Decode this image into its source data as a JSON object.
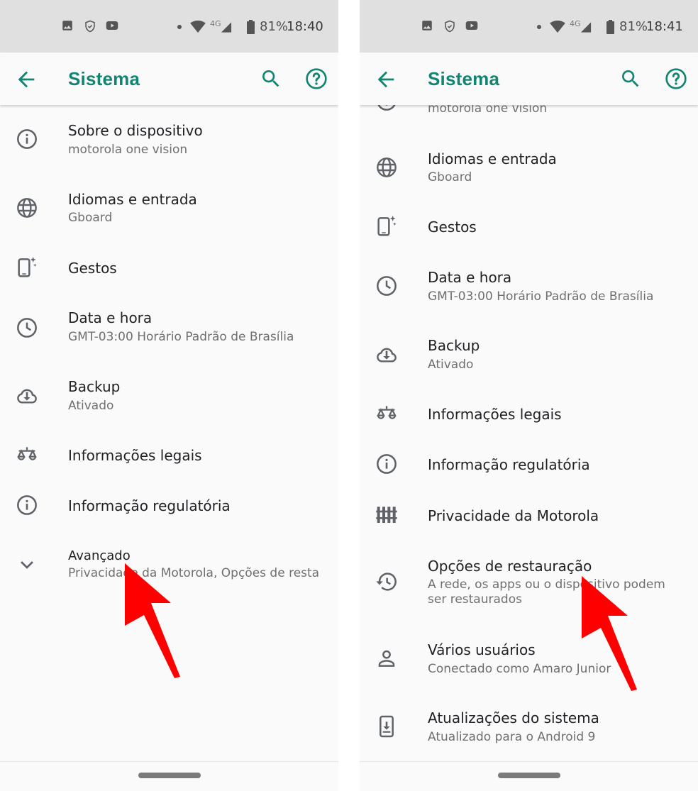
{
  "colors": {
    "accent": "#128572",
    "status_bar_bg": "#e0e0e0",
    "background": "#fafafa",
    "primary_text": "#202124",
    "secondary_text": "#6f6f6f",
    "icon": "#5f6368",
    "annotation_arrow": "#ff0000"
  },
  "screens": [
    {
      "status_bar": {
        "notification_icons": [
          "image-icon",
          "shield-icon",
          "youtube-icon"
        ],
        "network": "4G",
        "battery": "81%",
        "time": "18:40"
      },
      "app_bar": {
        "title": "Sistema",
        "back_icon": "arrow-back-icon",
        "search_icon": "search-icon",
        "help_icon": "help-icon"
      },
      "items": [
        {
          "icon": "info-icon",
          "label": "Sobre o dispositivo",
          "summary": "motorola one vision"
        },
        {
          "icon": "globe-icon",
          "label": "Idiomas e entrada",
          "summary": "Gboard"
        },
        {
          "icon": "gestures-icon",
          "label": "Gestos",
          "summary": ""
        },
        {
          "icon": "clock-icon",
          "label": "Data e hora",
          "summary": "GMT-03:00 Horário Padrão de Brasília"
        },
        {
          "icon": "cloud-backup-icon",
          "label": "Backup",
          "summary": "Ativado"
        },
        {
          "icon": "scales-icon",
          "label": "Informações legais",
          "summary": ""
        },
        {
          "icon": "info-icon",
          "label": "Informação regulatória",
          "summary": ""
        },
        {
          "icon": "chevron-down-icon",
          "label": "Avançado",
          "summary": "Privacidade da Motorola, Opções de resta.."
        }
      ]
    },
    {
      "status_bar": {
        "notification_icons": [
          "image-icon",
          "shield-icon",
          "youtube-icon"
        ],
        "network": "4G",
        "battery": "81%",
        "time": "18:41"
      },
      "app_bar": {
        "title": "Sistema",
        "back_icon": "arrow-back-icon",
        "search_icon": "search-icon",
        "help_icon": "help-icon"
      },
      "items": [
        {
          "icon": "info-icon",
          "label": "",
          "summary": "motorola one vision"
        },
        {
          "icon": "globe-icon",
          "label": "Idiomas e entrada",
          "summary": "Gboard"
        },
        {
          "icon": "gestures-icon",
          "label": "Gestos",
          "summary": ""
        },
        {
          "icon": "clock-icon",
          "label": "Data e hora",
          "summary": "GMT-03:00 Horário Padrão de Brasília"
        },
        {
          "icon": "cloud-backup-icon",
          "label": "Backup",
          "summary": "Ativado"
        },
        {
          "icon": "scales-icon",
          "label": "Informações legais",
          "summary": ""
        },
        {
          "icon": "info-icon",
          "label": "Informação regulatória",
          "summary": ""
        },
        {
          "icon": "fence-icon",
          "label": "Privacidade da Motorola",
          "summary": ""
        },
        {
          "icon": "restore-icon",
          "label": "Opções de restauração",
          "summary": "A rede, os apps ou o dispositivo podem ser restaurados"
        },
        {
          "icon": "person-icon",
          "label": "Vários usuários",
          "summary": "Conectado como Amaro Junior"
        },
        {
          "icon": "system-update-icon",
          "label": "Atualizações do sistema",
          "summary": "Atualizado para o Android 9"
        }
      ]
    }
  ]
}
